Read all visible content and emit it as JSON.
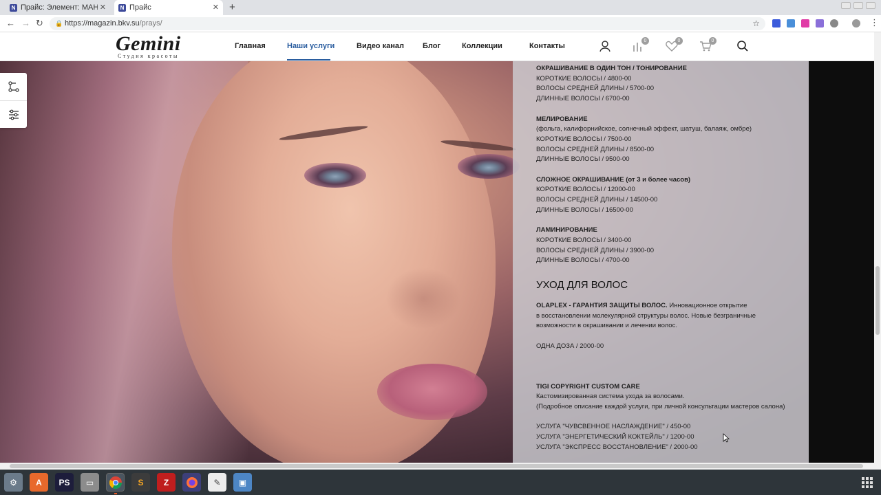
{
  "browser": {
    "tabs": [
      {
        "title": "Прайс: Элемент: МАНИК",
        "favicon": "N"
      },
      {
        "title": "Прайс",
        "favicon": "N"
      }
    ],
    "url_host": "https://magazin.bkv.su",
    "url_path": "/prays/"
  },
  "site": {
    "logo": "Gemini",
    "logo_sub": "Студия красоты",
    "menu": [
      "Главная",
      "Наши услуги",
      "Видео канал",
      "Блог",
      "Коллекции",
      "Контакты"
    ],
    "badges": {
      "compare": "0",
      "wishlist": "0",
      "cart": "0"
    }
  },
  "price": {
    "blocks": [
      {
        "title": "ОКРАШИВАНИЕ В ОДИН ТОН / ТОНИРОВАНИЕ",
        "lines": [
          "КОРОТКИЕ ВОЛОСЫ / 4800-00",
          "ВОЛОСЫ СРЕДНЕЙ ДЛИНЫ / 5700-00",
          "ДЛИННЫЕ ВОЛОСЫ / 6700-00"
        ]
      },
      {
        "title": "МЕЛИРОВАНИЕ",
        "lines": [
          "(фольга, калифорнийское, солнечный эффект, шатуш, балаяж, омбре)",
          "КОРОТКИЕ ВОЛОСЫ / 7500-00",
          "ВОЛОСЫ СРЕДНЕЙ ДЛИНЫ / 8500-00",
          "ДЛИННЫЕ ВОЛОСЫ / 9500-00"
        ]
      },
      {
        "title": "СЛОЖНОЕ ОКРАШИВАНИЕ (от 3 и более часов)",
        "lines": [
          "КОРОТКИЕ ВОЛОСЫ / 12000-00",
          "ВОЛОСЫ СРЕДНЕЙ ДЛИНЫ / 14500-00",
          "ДЛИННЫЕ ВОЛОСЫ / 16500-00"
        ]
      },
      {
        "title": "ЛАМИНИРОВАНИЕ",
        "lines": [
          "КОРОТКИЕ ВОЛОСЫ / 3400-00",
          "ВОЛОСЫ СРЕДНЕЙ ДЛИНЫ / 3900-00",
          "ДЛИННЫЕ ВОЛОСЫ / 4700-00"
        ]
      }
    ],
    "care_heading": "УХОД ДЛЯ ВОЛОС",
    "olaplex": {
      "title": "OLAPLEX - ГАРАНТИЯ ЗАЩИТЫ ВОЛОС.",
      "text1": " Инновационное открытие",
      "text2": " в восстановлении молекулярной структуры волос. Новые безграничные",
      "text3": " возможности в окрашивании и лечении волос.",
      "price": "ОДНА ДОЗА / 2000-00"
    },
    "tigi": {
      "title": "TIGI COPYRIGHT CUSTOM CARE",
      "desc1": "Кастомизированная система ухода за волосами.",
      "desc2": "(Подробное описание каждой услуги, при личной консультации мастеров салона)",
      "services": [
        "УСЛУГА \"ЧУВСВЕННОЕ НАСЛАЖДЕНИЕ\" / 450-00",
        "УСЛУГА \"ЭНЕРГЕТИЧЕСКИЙ КОКТЕЙЛЬ\" / 1200-00",
        "УСЛУГА \"ЭКСПРЕСС ВОССТАНОВЛЕНИЕ\" / 2000-00"
      ]
    }
  },
  "colors": {
    "accent": "#2a5d9f",
    "to_top": "#1f5fb4",
    "taskbar": "#2e353a"
  }
}
